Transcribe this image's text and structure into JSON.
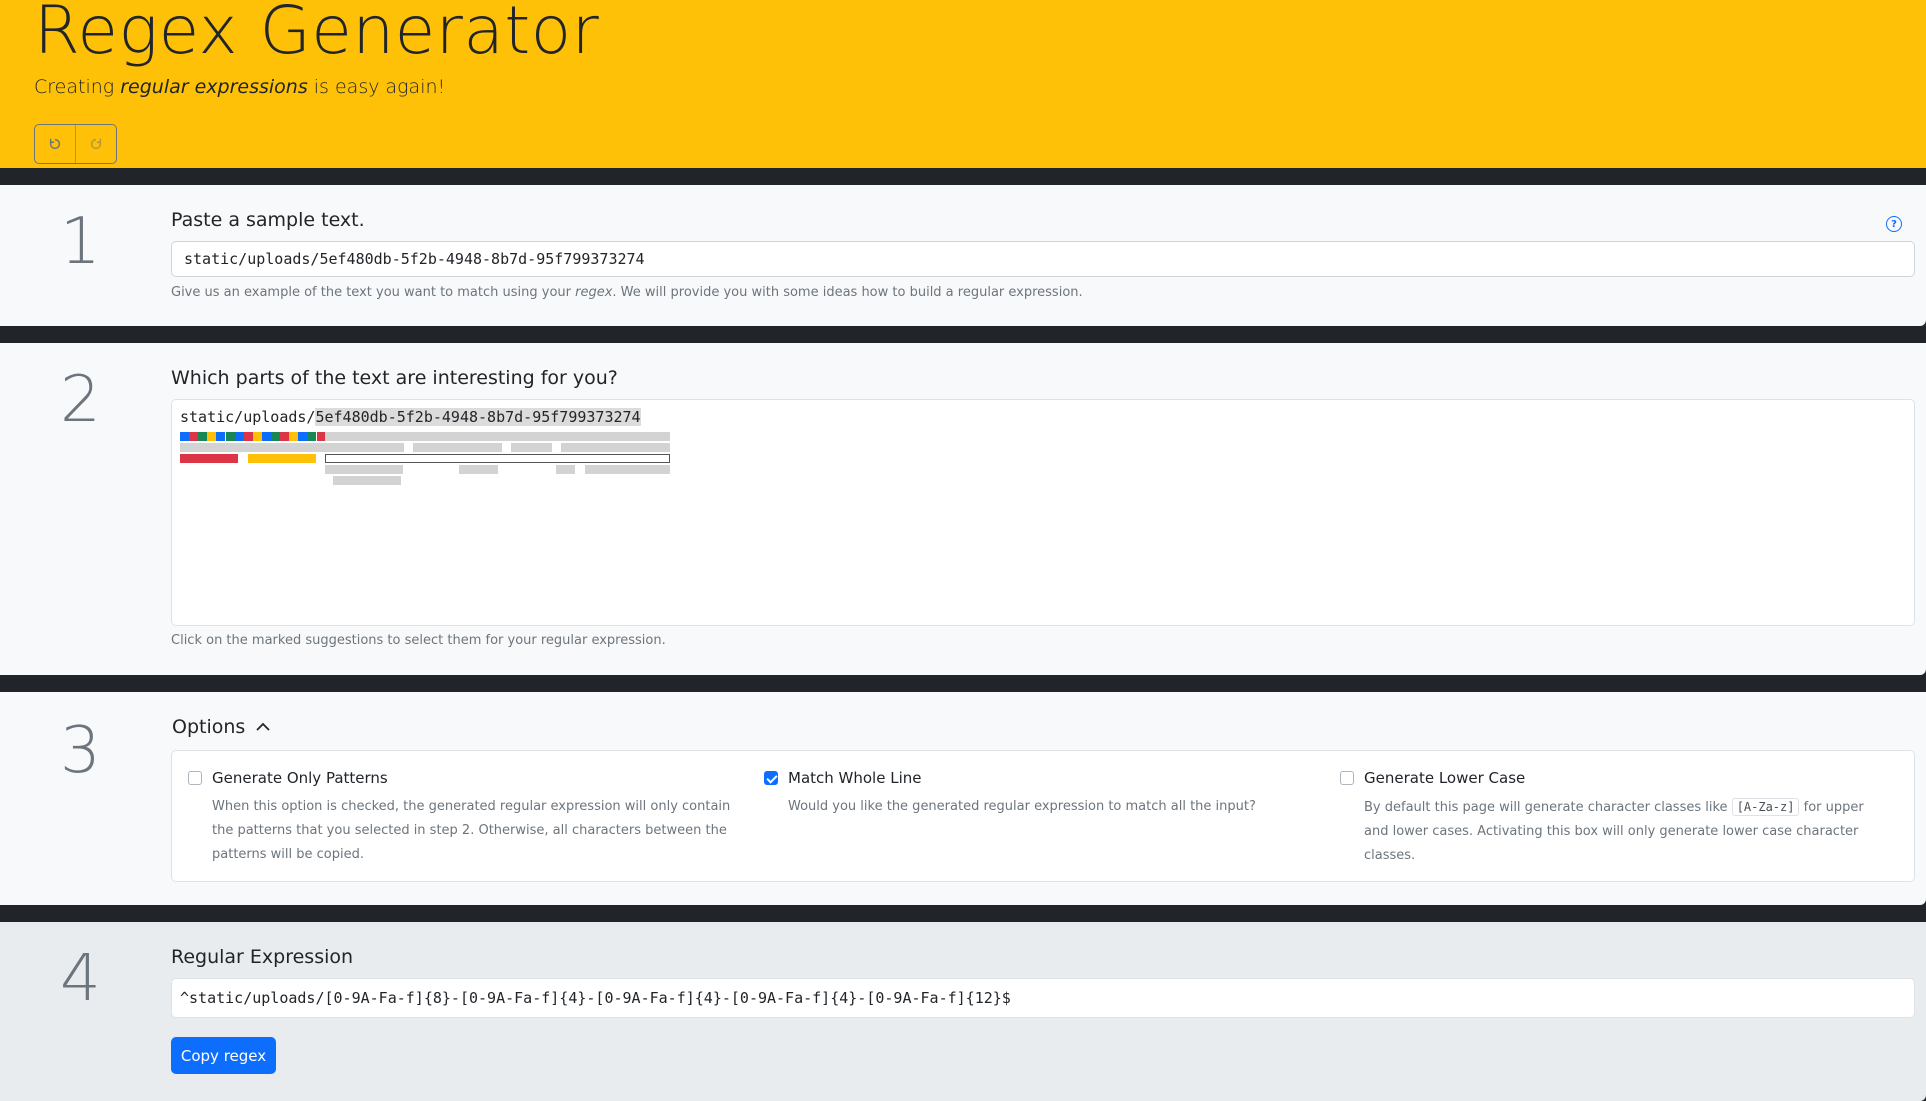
{
  "header": {
    "title": "Regex Generator",
    "subtitle_before": "Creating ",
    "subtitle_em": "regular expressions",
    "subtitle_after": " is easy again!",
    "undo_icon": "undo-icon",
    "redo_icon": "redo-icon"
  },
  "step1": {
    "number": "1",
    "label": "Paste a sample text.",
    "input_value": "static/uploads/5ef480db-5f2b-4948-8b7d-95f799373274",
    "help_before": "Give us an example of the text you want to match using your ",
    "help_em": "regex",
    "help_after": ". We will provide you with some ideas how to build a regular expression.",
    "help_icon": "?"
  },
  "step2": {
    "number": "2",
    "label": "Which parts of the text are interesting for you?",
    "sample_plain": "static/uploads/",
    "sample_highlight": "5ef480db-5f2b-4948-8b7d-95f799373274",
    "help": "Click on the marked suggestions to select them for your regular expression."
  },
  "step3": {
    "number": "3",
    "label": "Options",
    "toggle_icon": "chevron-up-icon",
    "options": [
      {
        "title": "Generate Only Patterns",
        "checked": false,
        "desc": "When this option is checked, the generated regular expression will only contain the patterns that you selected in step 2. Otherwise, all characters between the patterns will be copied."
      },
      {
        "title": "Match Whole Line",
        "checked": true,
        "desc": "Would you like the generated regular expression to match all the input?"
      },
      {
        "title": "Generate Lower Case",
        "checked": false,
        "desc_before": "By default this page will generate character classes like ",
        "desc_code": "[A-Za-z]",
        "desc_after": " for upper and lower cases. Activating this box will only generate lower case character classes."
      }
    ]
  },
  "step4": {
    "number": "4",
    "label": "Regular Expression",
    "regex": "^static/uploads/[0-9A-Fa-f]{8}-[0-9A-Fa-f]{4}-[0-9A-Fa-f]{4}-[0-9A-Fa-f]{4}-[0-9A-Fa-f]{12}$",
    "copy_label": "Copy regex"
  },
  "colors": {
    "header_bg": "#ffc107",
    "primary": "#0d6efd",
    "suggestion_blue": "#0d6efd",
    "suggestion_red": "#dc3545",
    "suggestion_green": "#198754",
    "suggestion_yellow": "#ffc107",
    "suggestion_gray": "#d3d3d3"
  }
}
